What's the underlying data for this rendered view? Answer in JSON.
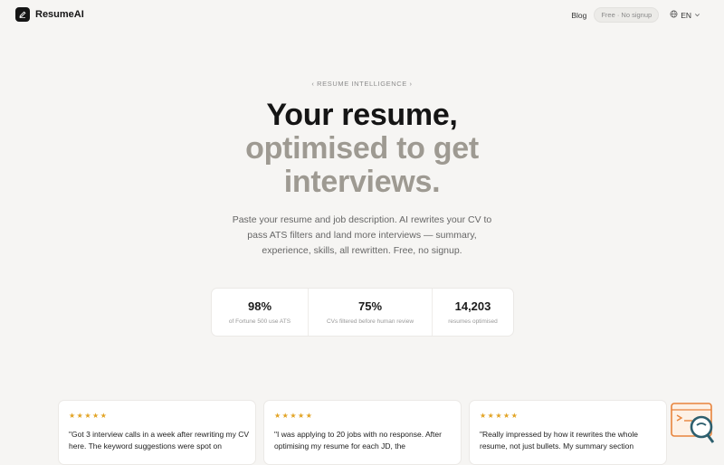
{
  "nav": {
    "brand": "ResumeAI",
    "blog": "Blog",
    "badge": "Free · No signup",
    "language": "EN"
  },
  "hero": {
    "eyebrow": "‹ RESUME INTELLIGENCE ›",
    "title_line1": "Your resume,",
    "title_line2": "optimised to get",
    "title_line3": "interviews.",
    "subtitle": "Paste your resume and job description. AI rewrites your CV to pass ATS filters and land more interviews — summary, experience, skills, all rewritten. Free, no signup."
  },
  "stats": [
    {
      "value": "98%",
      "label": "of Fortune 500 use ATS"
    },
    {
      "value": "75%",
      "label": "CVs filtered before human review"
    },
    {
      "value": "14,203",
      "label": "resumes optimised"
    }
  ],
  "testimonials": [
    {
      "stars": "★★★★★",
      "text": "\"Got 3 interview calls in a week after rewriting my CV here. The keyword suggestions were spot on"
    },
    {
      "stars": "★★★★★",
      "text": "\"I was applying to 20 jobs with no response. After optimising my resume for each JD, the"
    },
    {
      "stars": "★★★★★",
      "text": "\"Really impressed by how it rewrites the whole resume, not just bullets. My summary section"
    }
  ],
  "colors": {
    "background": "#f6f5f3",
    "title_dark": "#151515",
    "title_muted": "#9e9a92",
    "star": "#e2a323",
    "help_widget": "#e8843c"
  },
  "icons": {
    "logo": "pen-icon",
    "language": "globe-icon",
    "dropdown": "chevron-down-icon",
    "help": "help-search-icon"
  }
}
